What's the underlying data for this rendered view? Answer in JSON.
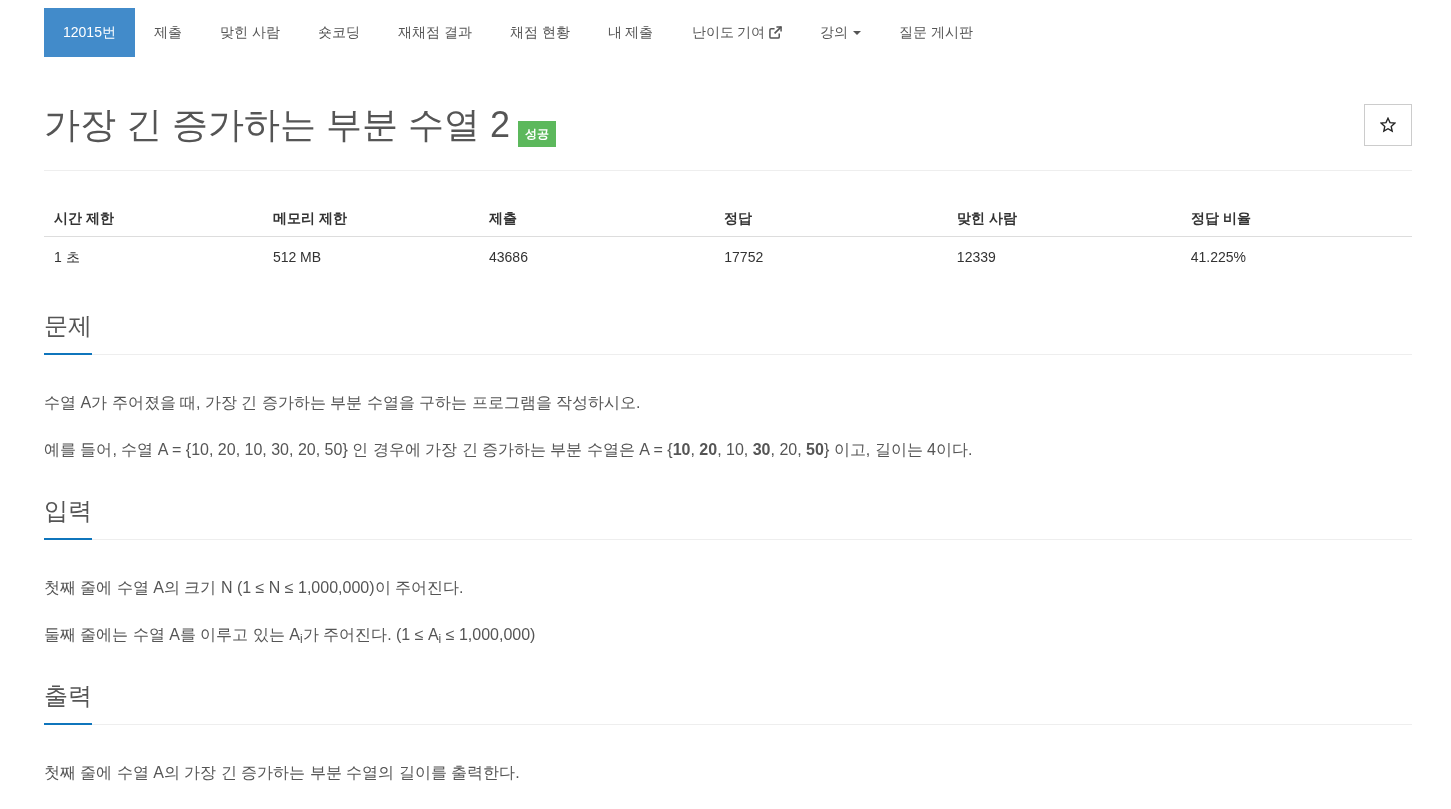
{
  "tabs": [
    {
      "label": "12015번",
      "kind": "link",
      "selected": true
    },
    {
      "label": "제출",
      "kind": "link",
      "selected": false
    },
    {
      "label": "맞힌 사람",
      "kind": "link",
      "selected": false
    },
    {
      "label": "숏코딩",
      "kind": "link",
      "selected": false
    },
    {
      "label": "재채점 결과",
      "kind": "link",
      "selected": false
    },
    {
      "label": "채점 현황",
      "kind": "link",
      "selected": false
    },
    {
      "label": "내 제출",
      "kind": "link",
      "selected": false
    },
    {
      "label": "난이도 기여",
      "kind": "external",
      "selected": false
    },
    {
      "label": "강의",
      "kind": "dropdown",
      "selected": false
    },
    {
      "label": "질문 게시판",
      "kind": "link",
      "selected": false
    }
  ],
  "problem": {
    "title": "가장 긴 증가하는 부분 수열 2",
    "result": "성공",
    "favorited": false
  },
  "info_table": {
    "columns": [
      "시간 제한",
      "메모리 제한",
      "제출",
      "정답",
      "맞힌 사람",
      "정답 비율"
    ],
    "rows": [
      [
        "1 초",
        "512 MB",
        "43686",
        "17752",
        "12339",
        "41.225%"
      ]
    ]
  },
  "sections": [
    {
      "heading": "문제",
      "paragraphs": [
        "수열 A가 주어졌을 때, 가장 긴 증가하는 부분 수열을 구하는 프로그램을 작성하시오.",
        "예를 들어, 수열 A = {10, 20, 10, 30, 20, 50} 인 경우에 가장 긴 증가하는 부분 수열은 A = {**10**, **20**, 10, **30**, 20, **50**} 이고, 길이는 4이다."
      ]
    },
    {
      "heading": "입력",
      "paragraphs": [
        "첫째 줄에 수열 A의 크기 N (1 ≤ N ≤ 1,000,000)이 주어진다.",
        "둘째 줄에는 수열 A를 이루고 있는 A$_{i}$가 주어진다. (1 ≤ A$_{i}$ ≤ 1,000,000)"
      ]
    },
    {
      "heading": "출력",
      "paragraphs": [
        "첫째 줄에 수열 A의 가장 긴 증가하는 부분 수열의 길이를 출력한다."
      ]
    }
  ]
}
